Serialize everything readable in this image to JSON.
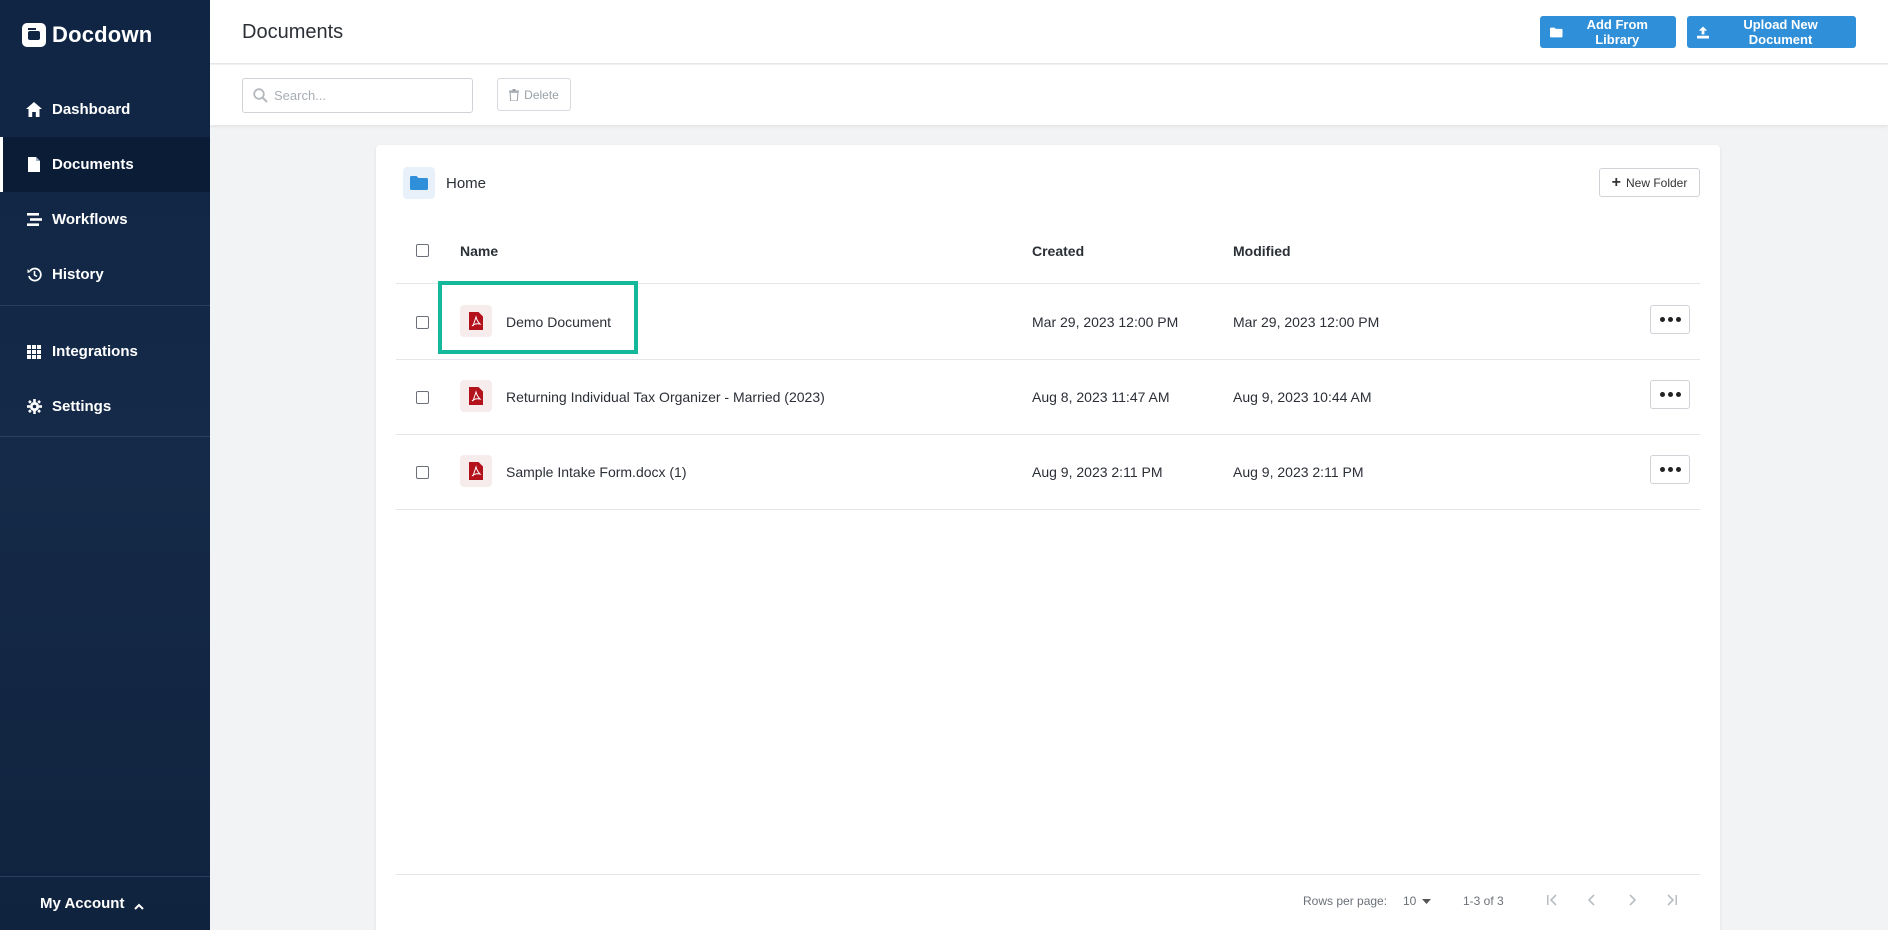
{
  "brand": {
    "name": "Docdown"
  },
  "sidebar": {
    "items": [
      {
        "label": "Dashboard",
        "icon": "home-icon"
      },
      {
        "label": "Documents",
        "icon": "document-icon",
        "active": true
      },
      {
        "label": "Workflows",
        "icon": "workflow-icon"
      },
      {
        "label": "History",
        "icon": "history-icon"
      },
      {
        "label": "Integrations",
        "icon": "grid-icon"
      },
      {
        "label": "Settings",
        "icon": "gear-icon"
      }
    ],
    "account_label": "My Account"
  },
  "header": {
    "title": "Documents",
    "add_library_label": "Add From Library",
    "upload_label": "Upload New Document"
  },
  "toolbar": {
    "search_placeholder": "Search...",
    "delete_label": "Delete"
  },
  "breadcrumb": {
    "label": "Home"
  },
  "new_folder_label": "New Folder",
  "table": {
    "columns": {
      "name": "Name",
      "created": "Created",
      "modified": "Modified"
    },
    "rows": [
      {
        "name": "Demo Document",
        "created": "Mar 29, 2023 12:00 PM",
        "modified": "Mar 29, 2023 12:00 PM"
      },
      {
        "name": "Returning Individual Tax Organizer - Married (2023)",
        "created": "Aug 8, 2023 11:47 AM",
        "modified": "Aug 9, 2023 10:44 AM"
      },
      {
        "name": "Sample Intake Form.docx (1)",
        "created": "Aug 9, 2023 2:11 PM",
        "modified": "Aug 9, 2023 2:11 PM"
      }
    ]
  },
  "pagination": {
    "rows_per_page_label": "Rows per page:",
    "rows_per_page": "10",
    "range": "1-3 of 3"
  },
  "colors": {
    "sidebar_bg": "#0f2543",
    "primary": "#2f8fd8",
    "highlight": "#14b89a",
    "pdf_red": "#b3121d"
  }
}
